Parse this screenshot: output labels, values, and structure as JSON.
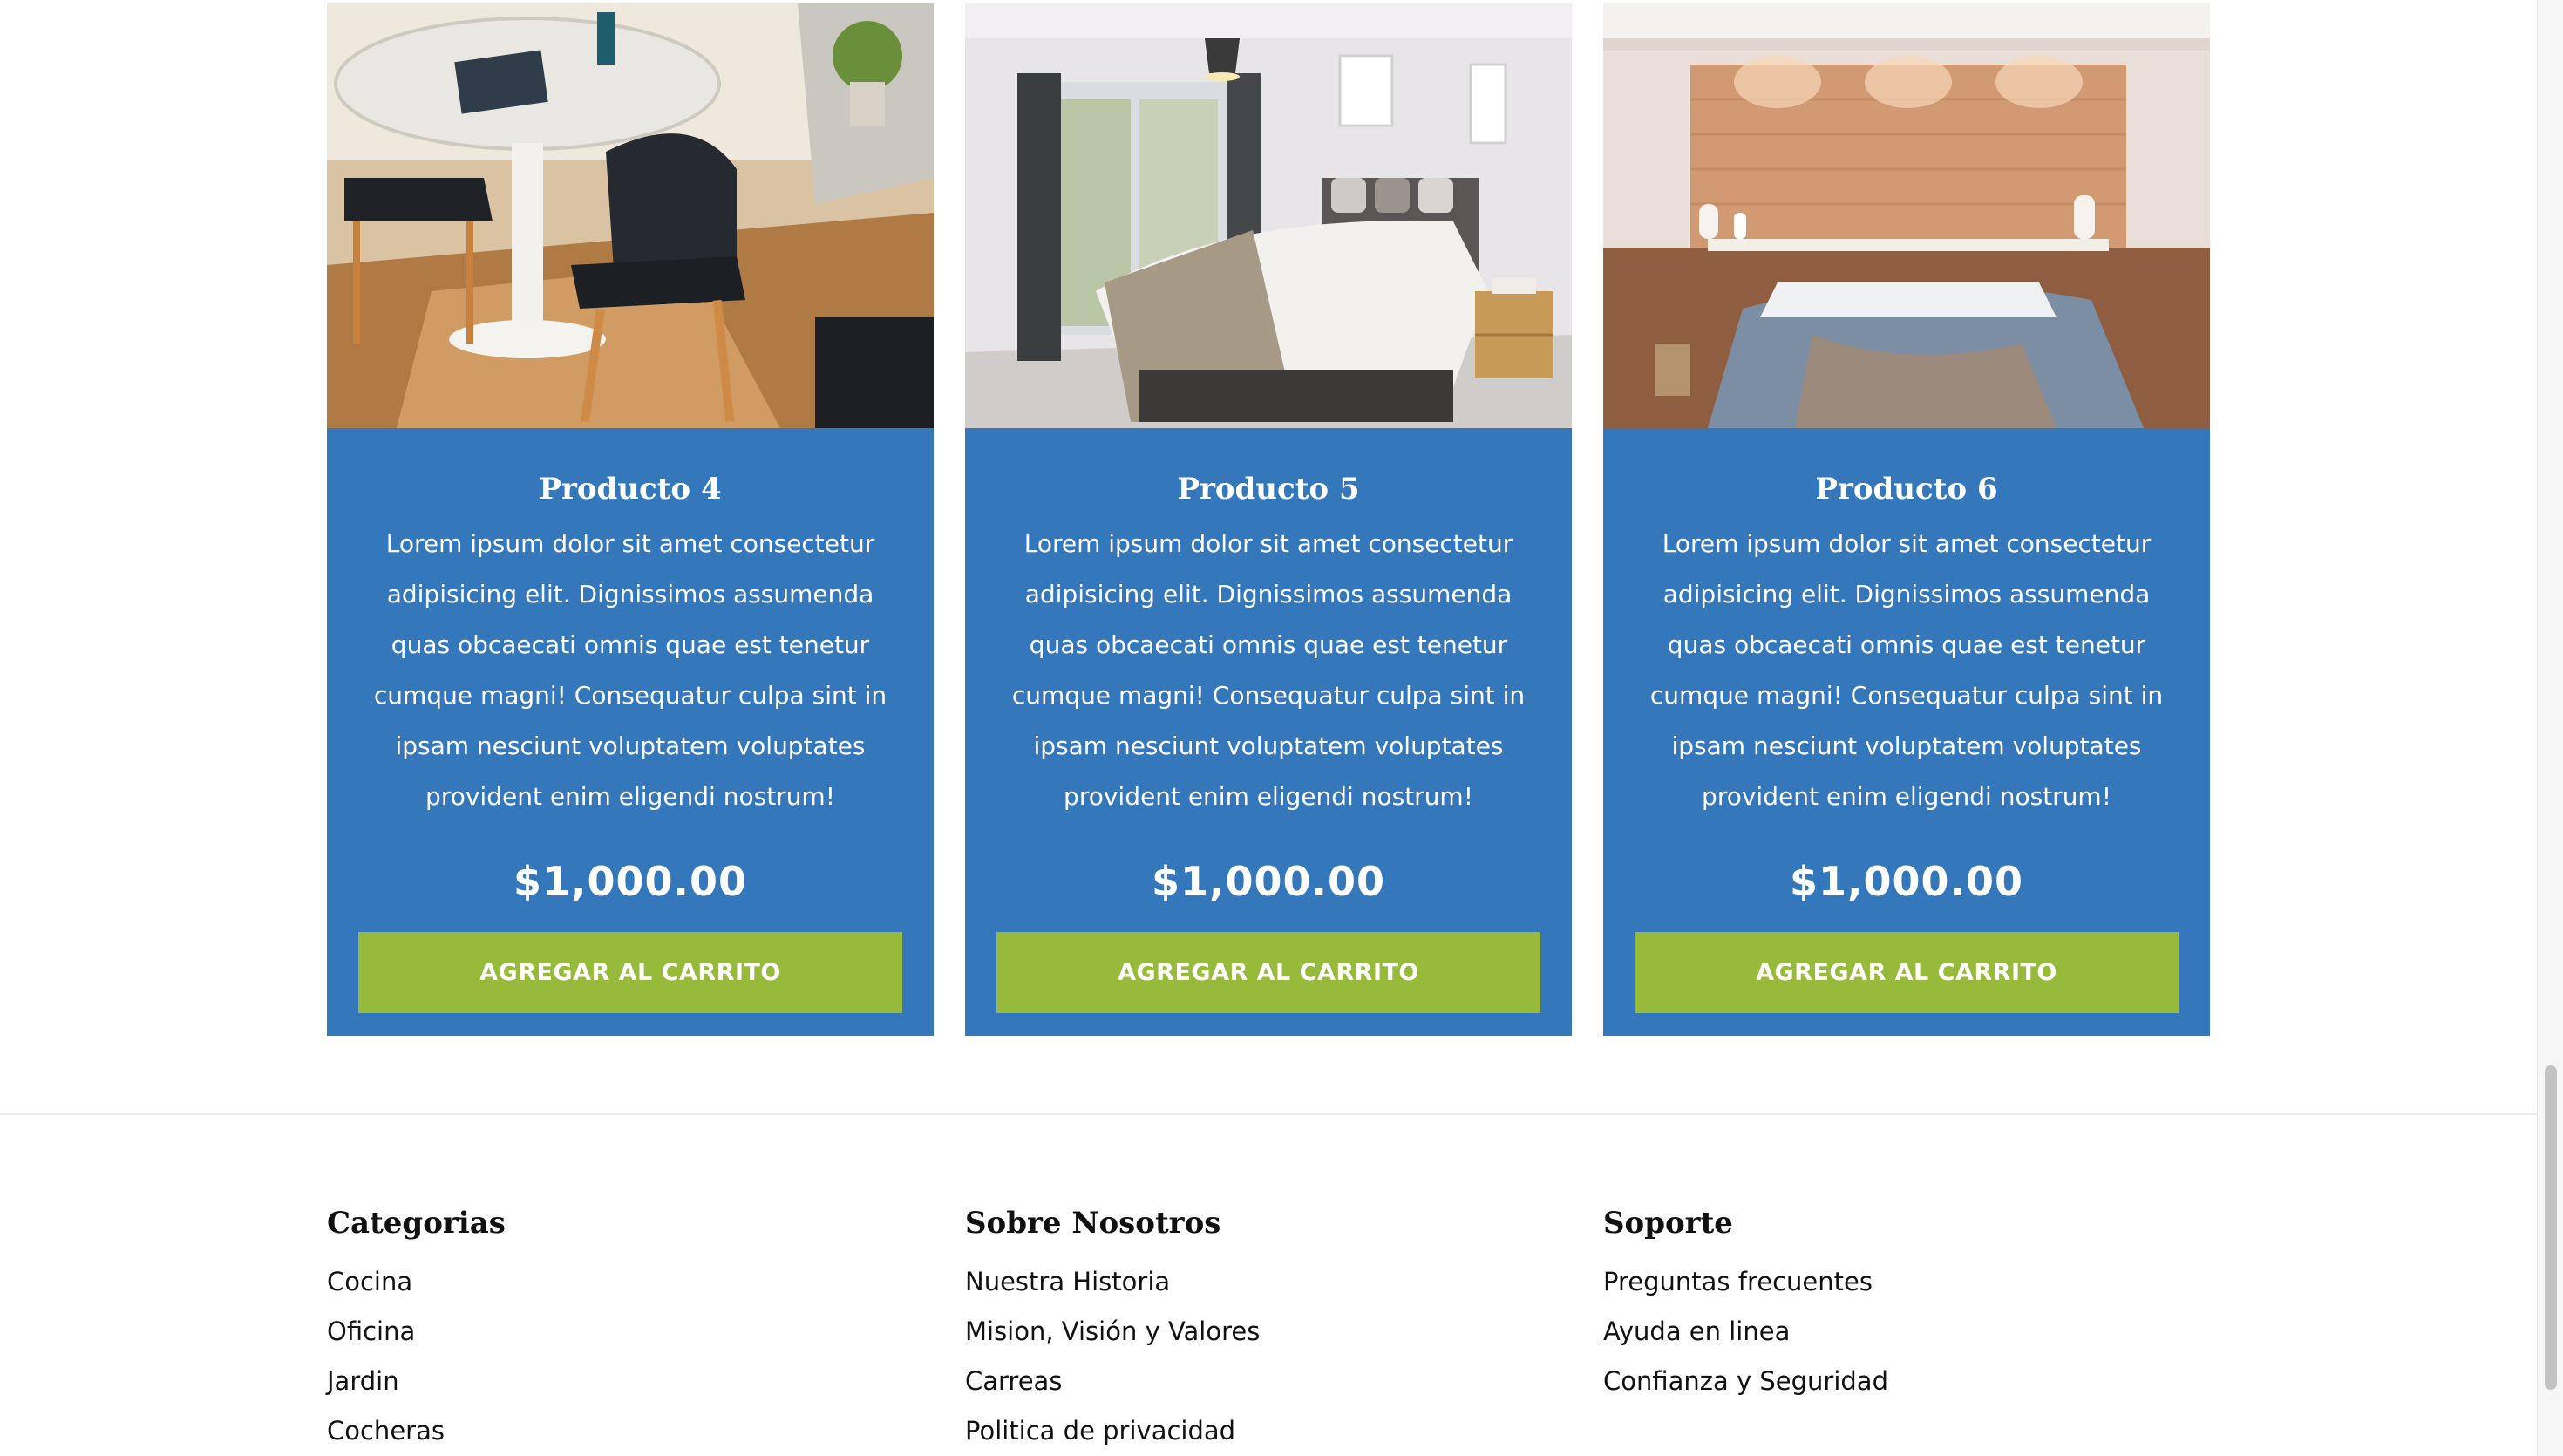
{
  "colors": {
    "card_bg": "#3477bb",
    "button_bg": "#97ba3b",
    "text_light": "#ffffff",
    "text_dark": "#111111"
  },
  "products": [
    {
      "title": "Producto 4",
      "image": "dining-table-chairs-photo",
      "description": "Lorem ipsum dolor sit amet consectetur adipisicing elit. Dignissimos assumenda quas obcaecati omnis quae est tenetur cumque magni! Consequatur culpa sint in ipsam nesciunt voluptatem voluptates provident enim eligendi nostrum!",
      "price": "$1,000.00",
      "button_label": "AGREGAR AL CARRITO"
    },
    {
      "title": "Producto 5",
      "image": "bedroom-window-photo",
      "description": "Lorem ipsum dolor sit amet consectetur adipisicing elit. Dignissimos assumenda quas obcaecati omnis quae est tenetur cumque magni! Consequatur culpa sint in ipsam nesciunt voluptatem voluptates provident enim eligendi nostrum!",
      "price": "$1,000.00",
      "button_label": "AGREGAR AL CARRITO"
    },
    {
      "title": "Producto 6",
      "image": "wood-panel-bedroom-photo",
      "description": "Lorem ipsum dolor sit amet consectetur adipisicing elit. Dignissimos assumenda quas obcaecati omnis quae est tenetur cumque magni! Consequatur culpa sint in ipsam nesciunt voluptatem voluptates provident enim eligendi nostrum!",
      "price": "$1,000.00",
      "button_label": "AGREGAR AL CARRITO"
    }
  ],
  "footer": {
    "columns": [
      {
        "heading": "Categorias",
        "links": [
          "Cocina",
          "Oficina",
          "Jardin",
          "Cocheras"
        ]
      },
      {
        "heading": "Sobre Nosotros",
        "links": [
          "Nuestra Historia",
          "Mision, Visión y Valores",
          "Carreas",
          "Politica de privacidad"
        ]
      },
      {
        "heading": "Soporte",
        "links": [
          "Preguntas frecuentes",
          "Ayuda en linea",
          "Confianza y Seguridad"
        ]
      }
    ]
  }
}
